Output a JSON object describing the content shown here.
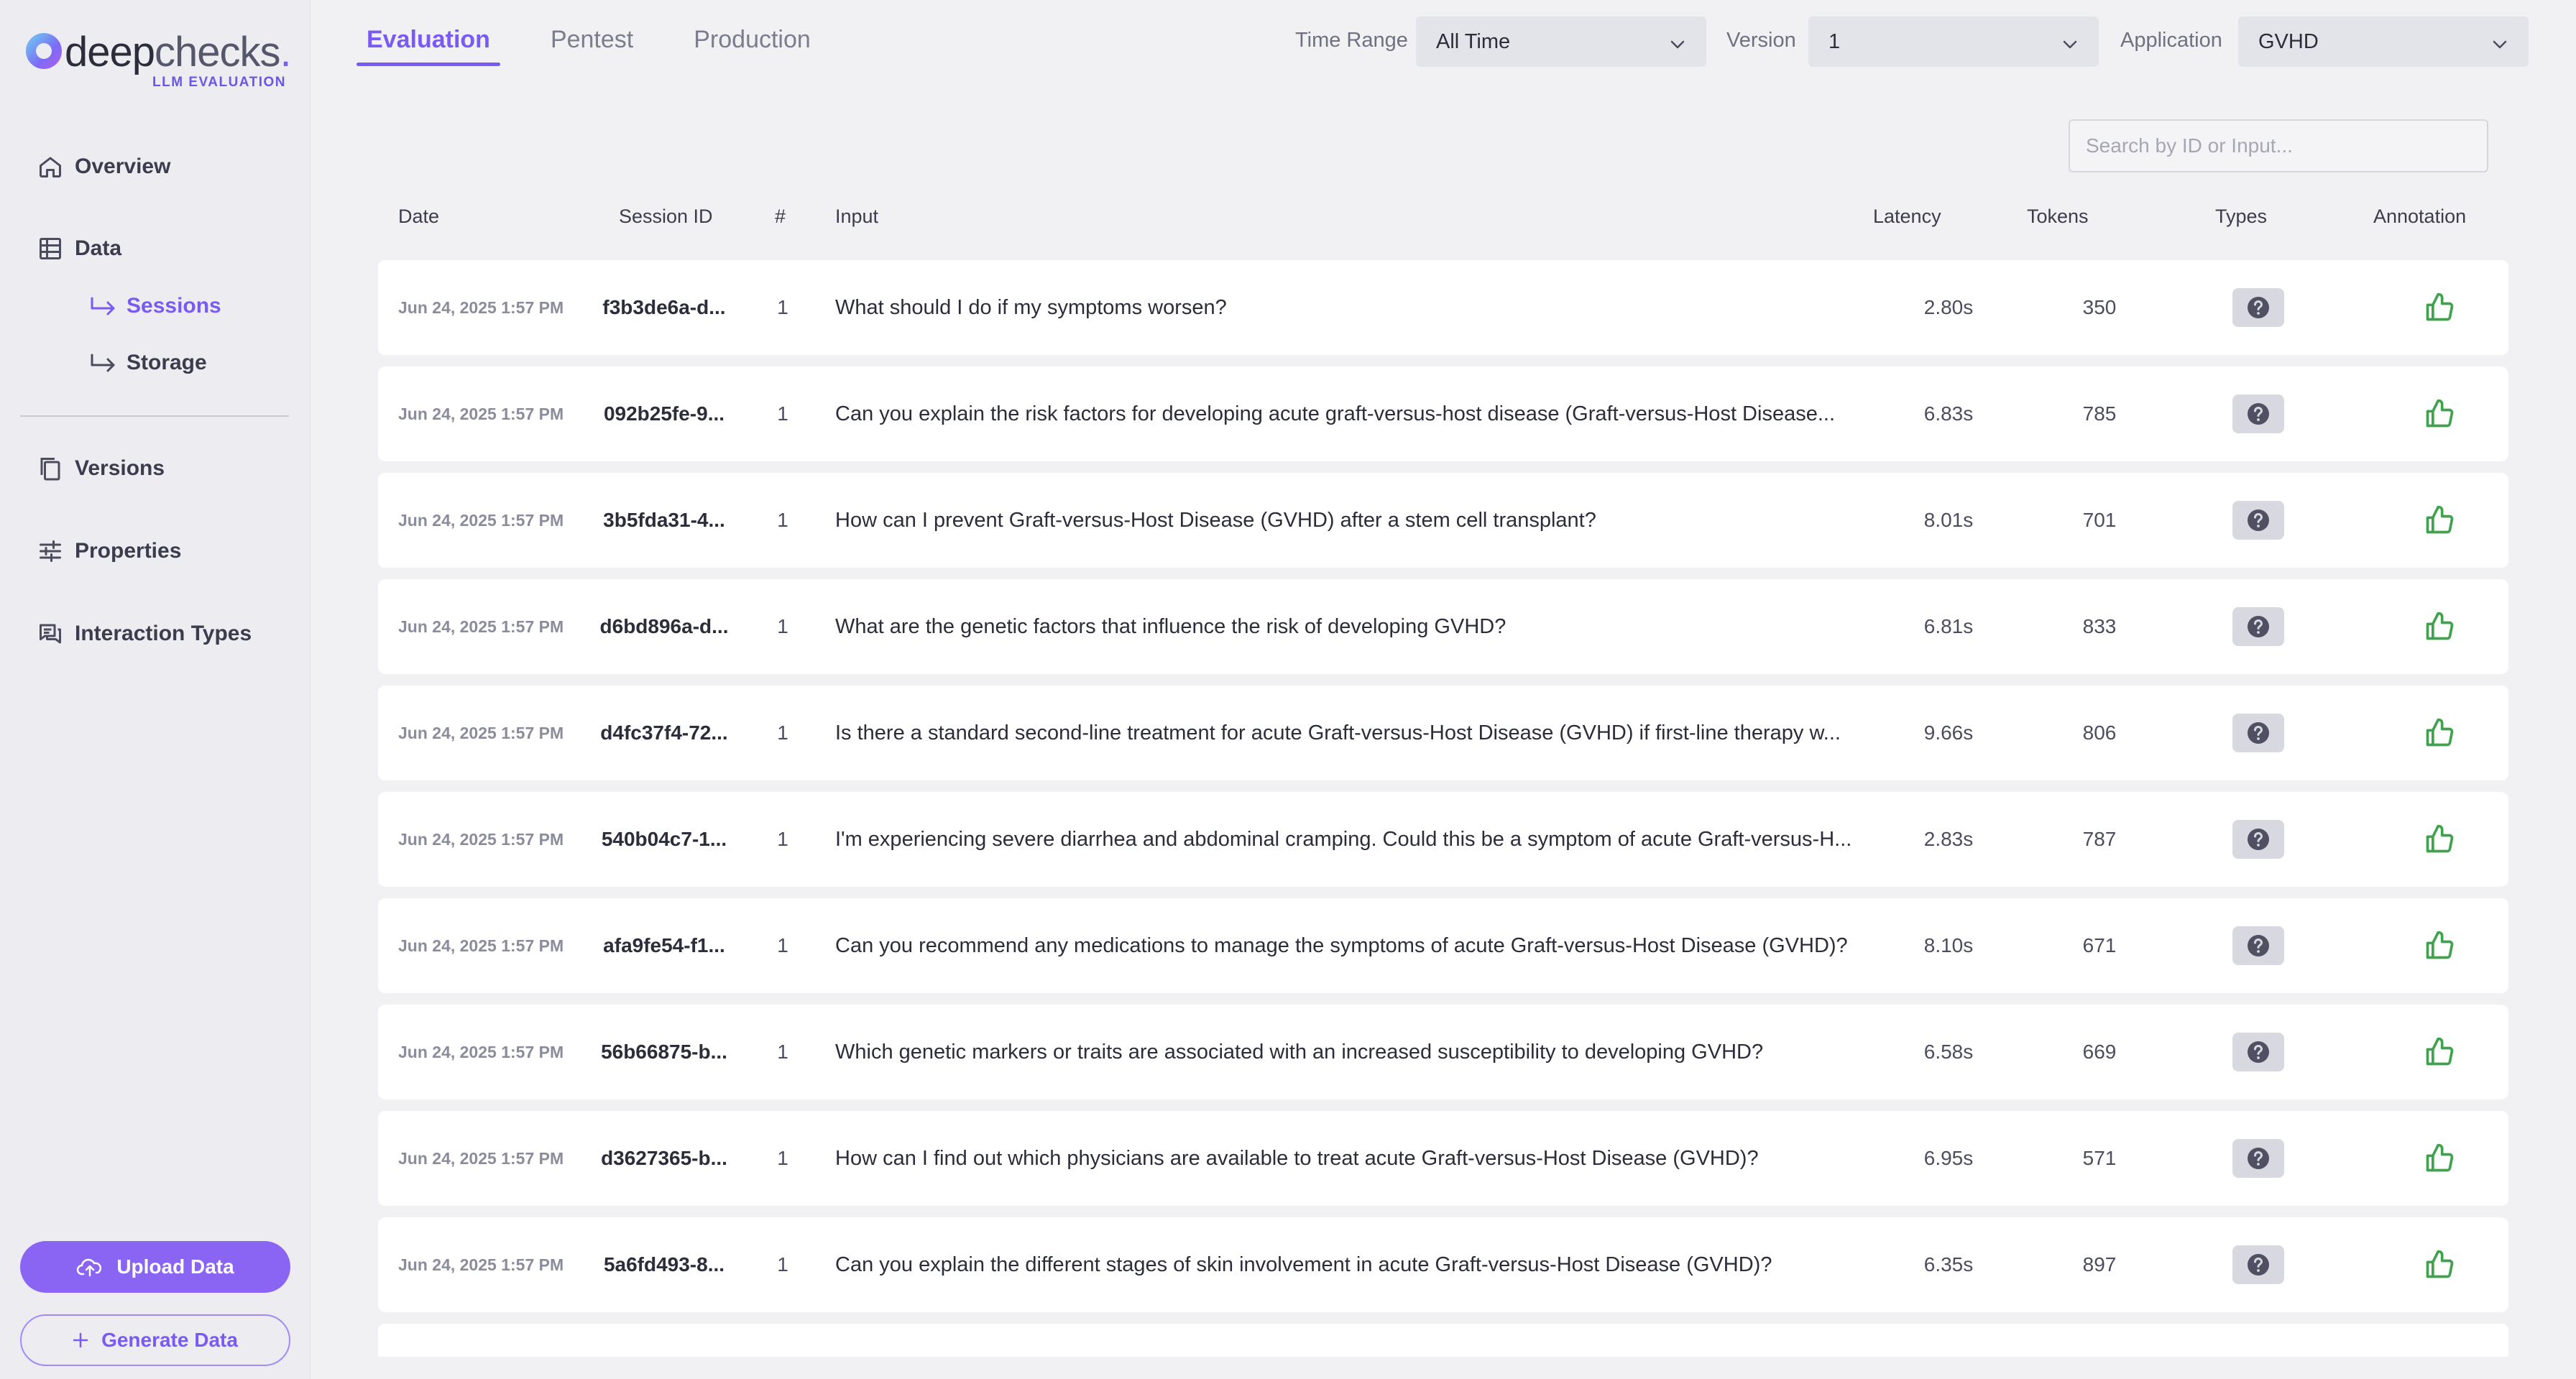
{
  "app": {
    "logo_text_a": "deep",
    "logo_text_b": "checks",
    "logo_dot": ".",
    "logo_subtitle": "LLM EVALUATION"
  },
  "sidebar": {
    "items": [
      {
        "label": "Overview",
        "icon": "home-icon"
      },
      {
        "label": "Data",
        "icon": "table-icon"
      },
      {
        "label": "Versions",
        "icon": "copy-icon"
      },
      {
        "label": "Properties",
        "icon": "sliders-icon"
      },
      {
        "label": "Interaction Types",
        "icon": "chat-icon"
      }
    ],
    "subitems": [
      {
        "label": "Sessions",
        "icon": "arrow-right-icon",
        "active": true
      },
      {
        "label": "Storage",
        "icon": "arrow-right-icon",
        "active": false
      }
    ],
    "upload_label": "Upload Data",
    "generate_label": "Generate Data"
  },
  "header": {
    "tabs": [
      {
        "label": "Evaluation",
        "active": true
      },
      {
        "label": "Pentest",
        "active": false
      },
      {
        "label": "Production",
        "active": false
      }
    ],
    "filters": {
      "time_range_label": "Time Range",
      "time_range_value": "All Time",
      "version_label": "Version",
      "version_value": "1",
      "application_label": "Application",
      "application_value": "GVHD"
    },
    "search_placeholder": "Search by ID or Input..."
  },
  "table": {
    "columns": [
      "Date",
      "Session ID",
      "#",
      "Input",
      "Latency",
      "Tokens",
      "Types",
      "Annotation"
    ],
    "rows": [
      {
        "date": "Jun 24, 2025 1:57 PM",
        "session_id": "f3b3de6a-d...",
        "num": "1",
        "input": "What should I do if my symptoms worsen?",
        "latency": "2.80s",
        "tokens": "350"
      },
      {
        "date": "Jun 24, 2025 1:57 PM",
        "session_id": "092b25fe-9...",
        "num": "1",
        "input": "Can you explain the risk factors for developing acute graft-versus-host disease (Graft-versus-Host Disease...",
        "latency": "6.83s",
        "tokens": "785"
      },
      {
        "date": "Jun 24, 2025 1:57 PM",
        "session_id": "3b5fda31-4...",
        "num": "1",
        "input": "How can I prevent Graft-versus-Host Disease (GVHD) after a stem cell transplant?",
        "latency": "8.01s",
        "tokens": "701"
      },
      {
        "date": "Jun 24, 2025 1:57 PM",
        "session_id": "d6bd896a-d...",
        "num": "1",
        "input": "What are the genetic factors that influence the risk of developing GVHD?",
        "latency": "6.81s",
        "tokens": "833"
      },
      {
        "date": "Jun 24, 2025 1:57 PM",
        "session_id": "d4fc37f4-72...",
        "num": "1",
        "input": "Is there a standard second-line treatment for acute Graft-versus-Host Disease (GVHD) if first-line therapy w...",
        "latency": "9.66s",
        "tokens": "806"
      },
      {
        "date": "Jun 24, 2025 1:57 PM",
        "session_id": "540b04c7-1...",
        "num": "1",
        "input": "I'm experiencing severe diarrhea and abdominal cramping. Could this be a symptom of acute Graft-versus-H...",
        "latency": "2.83s",
        "tokens": "787"
      },
      {
        "date": "Jun 24, 2025 1:57 PM",
        "session_id": "afa9fe54-f1...",
        "num": "1",
        "input": "Can you recommend any medications to manage the symptoms of acute Graft-versus-Host Disease (GVHD)?",
        "latency": "8.10s",
        "tokens": "671"
      },
      {
        "date": "Jun 24, 2025 1:57 PM",
        "session_id": "56b66875-b...",
        "num": "1",
        "input": "Which genetic markers or traits are associated with an increased susceptibility to developing GVHD?",
        "latency": "6.58s",
        "tokens": "669"
      },
      {
        "date": "Jun 24, 2025 1:57 PM",
        "session_id": "d3627365-b...",
        "num": "1",
        "input": "How can I find out which physicians are available to treat acute Graft-versus-Host Disease (GVHD)?",
        "latency": "6.95s",
        "tokens": "571"
      },
      {
        "date": "Jun 24, 2025 1:57 PM",
        "session_id": "5a6fd493-8...",
        "num": "1",
        "input": "Can you explain the different stages of skin involvement in acute Graft-versus-Host Disease (GVHD)?",
        "latency": "6.35s",
        "tokens": "897"
      }
    ],
    "type_icon": "question-icon",
    "annotation_icon": "thumbs-up-icon"
  },
  "colors": {
    "accent": "#7a5af5",
    "thumbs_up": "#3fa34d",
    "badge_bg": "#d8d8e0"
  }
}
